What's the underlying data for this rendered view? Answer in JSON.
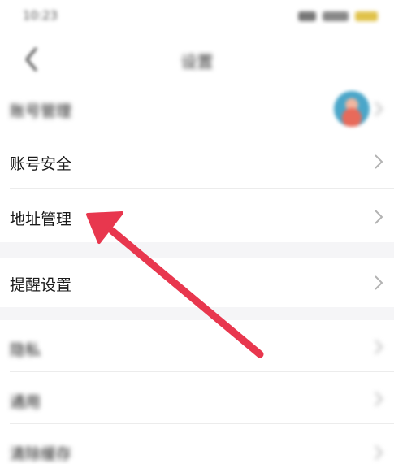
{
  "status_bar": {
    "time": "10:23"
  },
  "nav": {
    "title": "设置"
  },
  "rows": [
    {
      "label": "账号管理"
    },
    {
      "label": "账号安全"
    },
    {
      "label": "地址管理"
    },
    {
      "label": "提醒设置"
    },
    {
      "label": "隐私"
    },
    {
      "label": "通用"
    },
    {
      "label": "清除缓存"
    }
  ],
  "annotation": {
    "color": "#e8374e"
  },
  "colors": {
    "background": "#ffffff",
    "section_gap": "#f5f5f7",
    "divider": "#ececec",
    "chevron": "#b3b3b3"
  }
}
